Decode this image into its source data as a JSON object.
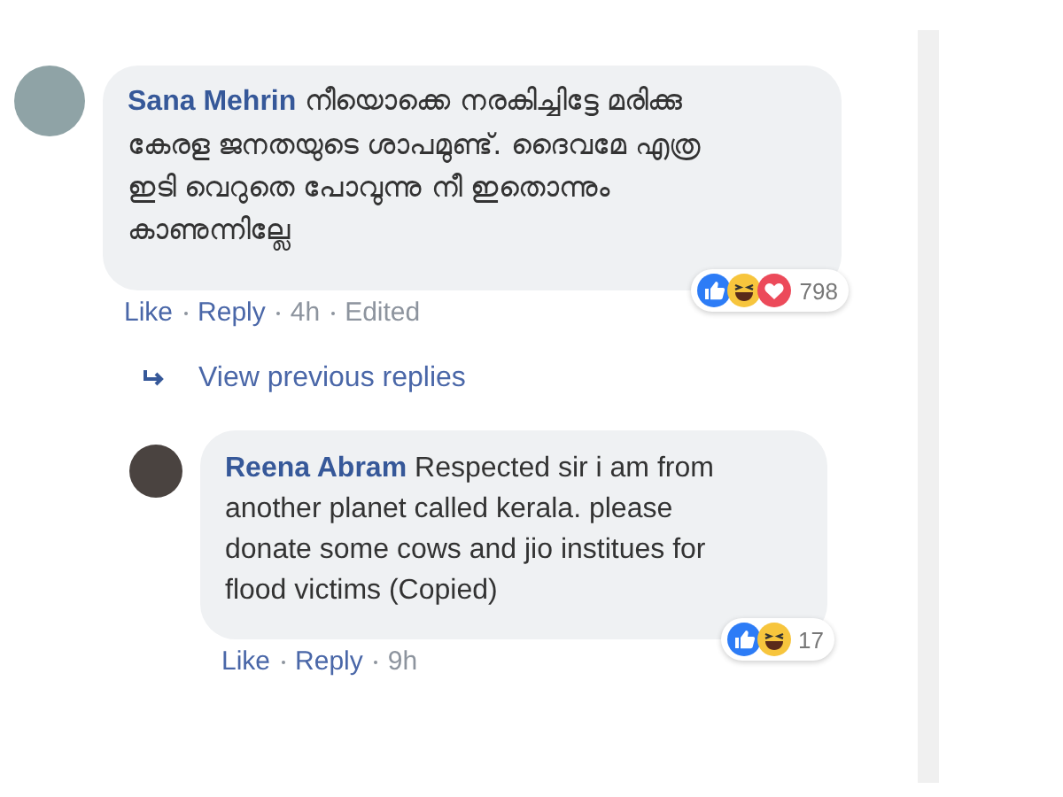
{
  "comment": {
    "author": "Sana Mehrin",
    "text": "നീയൊക്കെ നരകിച്ചിട്ടേ മരിക്കു കേരള ജനതയുടെ ശാപമുണ്ട്. ദൈവമേ എത്ര ഇടി വെറുതെ പോവുന്നു നീ ഇതൊന്നും കാണുന്നില്ലേ",
    "reactions": [
      {
        "kind": "like"
      },
      {
        "kind": "haha"
      },
      {
        "kind": "love"
      }
    ],
    "reaction_count": "798",
    "actions": [
      "Like",
      "Reply"
    ],
    "time": "4h",
    "edited": "Edited"
  },
  "view_previous": "View previous replies",
  "reply": {
    "author": "Reena Abram",
    "text": "Respected sir i am from another planet called kerala. please donate some cows and jio institues for flood victims (Copied)",
    "reactions": [
      {
        "kind": "like"
      },
      {
        "kind": "haha"
      }
    ],
    "reaction_count": "17",
    "actions": [
      "Like",
      "Reply"
    ],
    "time": "9h"
  }
}
